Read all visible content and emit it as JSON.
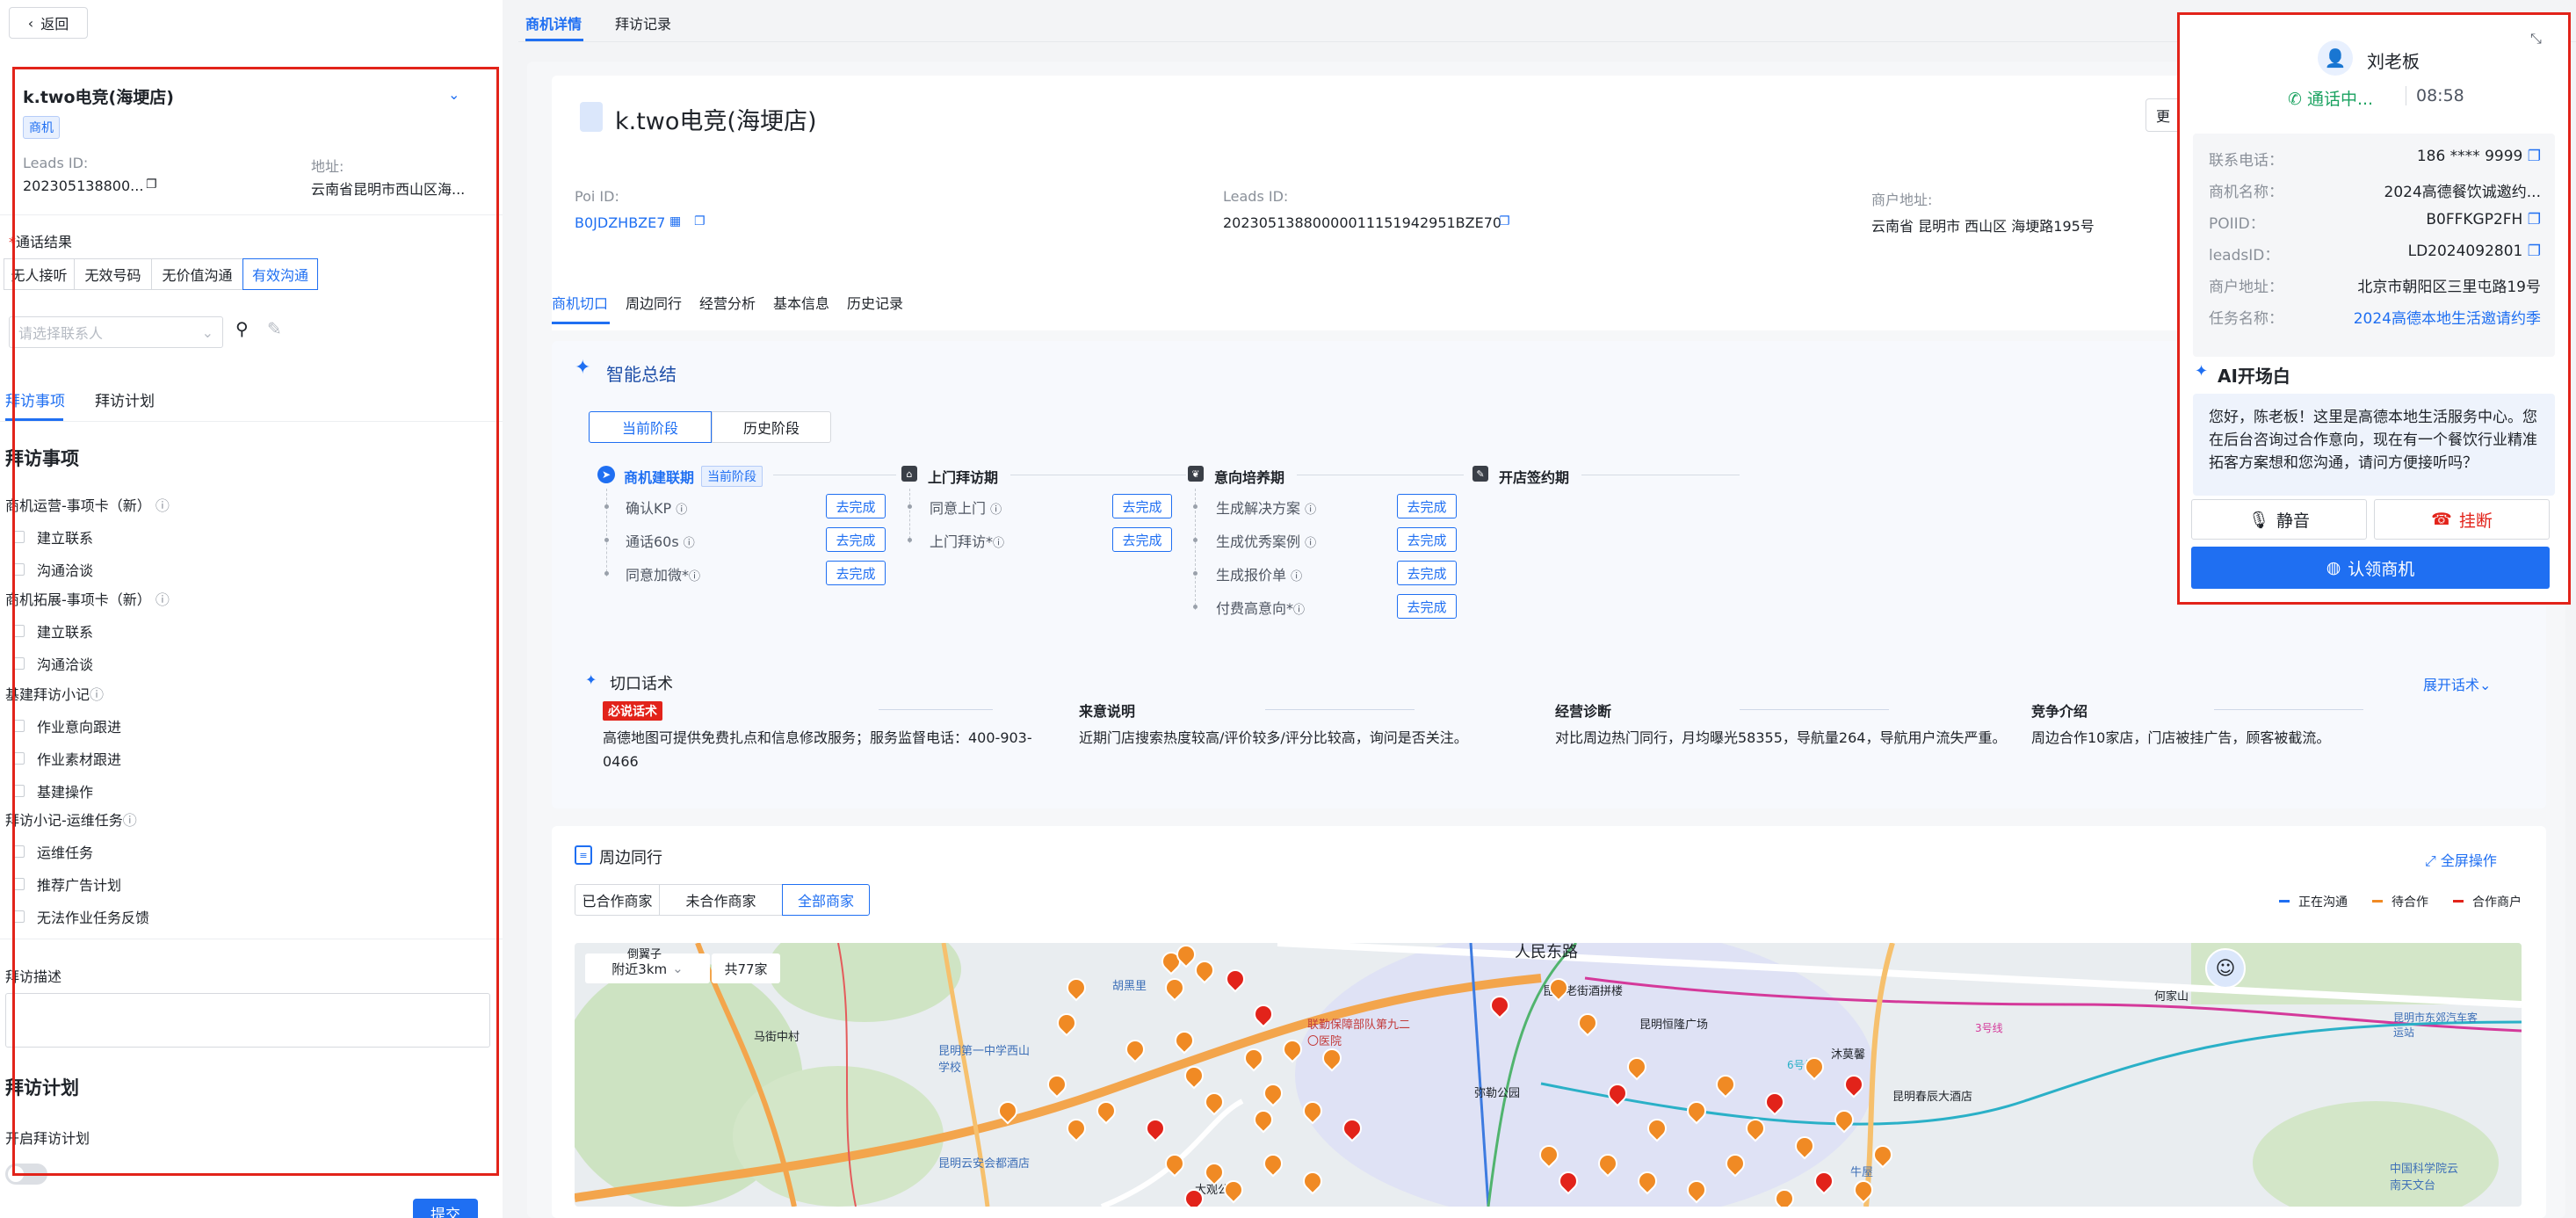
{
  "left": {
    "back_label": "返回",
    "store_name": "k.two电竞(海埂店)",
    "badge": "商机",
    "leads_id_label": "Leads ID:",
    "leads_id_value": "202305138800...",
    "address_label": "地址:",
    "address_value": "云南省昆明市西山区海...",
    "call_result_label": "通话结果",
    "call_results": [
      "无人接听",
      "无效号码",
      "无价值沟通",
      "有效沟通"
    ],
    "contact_placeholder": "请选择联系人",
    "tabs": [
      "拜访事项",
      "拜访计划"
    ],
    "visit_items_title": "拜访事项",
    "groups": [
      {
        "title": "商机运营-事项卡（新）",
        "items": [
          "建立联系",
          "沟通洽谈"
        ]
      },
      {
        "title": "商机拓展-事项卡（新）",
        "items": [
          "建立联系",
          "沟通洽谈"
        ]
      },
      {
        "title": "基建拜访小记",
        "items": [
          "作业意向跟进",
          "作业素材跟进",
          "基建操作"
        ]
      },
      {
        "title": "拜访小记-运维任务",
        "items": [
          "运维任务",
          "推荐广告计划",
          "无法作业任务反馈"
        ]
      }
    ],
    "visit_desc_label": "拜访描述",
    "visit_plan_title": "拜访计划",
    "enable_plan_label": "开启拜访计划",
    "submit_label": "提交"
  },
  "main": {
    "top_tabs": [
      "商机详情",
      "拜访记录"
    ],
    "store_name": "k.two电竞(海埂店)",
    "more_label": "更",
    "poi_label": "Poi ID:",
    "poi_value": "B0JDZHBZE7",
    "leads_label": "Leads ID:",
    "leads_value": "20230513880000011151942951BZE70",
    "addr_label": "商户地址:",
    "addr_value": "云南省 昆明市 西山区 海埂路195号",
    "sub_tabs": [
      "商机切口",
      "周边同行",
      "经营分析",
      "基本信息",
      "历史记录"
    ],
    "smart_title": "智能总结",
    "stage_tabs": [
      "当前阶段",
      "历史阶段"
    ],
    "stages": [
      {
        "name": "商机建联期",
        "tag": "当前阶段",
        "items": [
          "确认KP",
          "通话60s",
          "同意加微*"
        ]
      },
      {
        "name": "上门拜访期",
        "items": [
          "同意上门",
          "上门拜访*"
        ]
      },
      {
        "name": "意向培养期",
        "items": [
          "生成解决方案",
          "生成优秀案例",
          "生成报价单",
          "付费高意向*"
        ]
      },
      {
        "name": "开店签约期",
        "items": []
      }
    ],
    "done_label": "去完成",
    "cut_title": "切口话术",
    "expand_label": "展开话术",
    "scripts": [
      {
        "title": "",
        "tag": "必说话术",
        "text": "高德地图可提供免费扎点和信息修改服务；服务监督电话：400-903-0466"
      },
      {
        "title": "来意说明",
        "text": "近期门店搜索热度较高/评价较多/评分比较高，询问是否关注。"
      },
      {
        "title": "经营诊断",
        "text": "对比周边热门同行，月均曝光58355，导航量264，导航用户流失严重。"
      },
      {
        "title": "竞争介绍",
        "text": "周边合作10家店，门店被挂广告，顾客被截流。"
      }
    ],
    "peer_title": "周边同行",
    "fullscreen_label": "全屏操作",
    "peer_tabs": [
      "已合作商家",
      "未合作商家",
      "全部商家"
    ],
    "legend": [
      "正在沟通",
      "待合作",
      "合作商户"
    ],
    "legend_colors": [
      "#1f6ff2",
      "#f08a24",
      "#e2231a"
    ],
    "map_filter": "附近3km",
    "map_total": "共77家",
    "map_labels": [
      "倒翼子",
      "胡黑里",
      "马街中村",
      "昆明第一中学西山学校",
      "联勤保障部队第九二〇医院",
      "昆明云安会都酒店",
      "大观公园",
      "人民东路",
      "昆明老街酒拼楼",
      "昆明恒隆广场",
      "沐莫馨",
      "昆明春辰大酒店",
      "牛屋",
      "何家山",
      "3号线",
      "6号线",
      "中国科学院云南天文台",
      "昆明市东郊汽车客运站",
      "弥勒公园"
    ]
  },
  "call": {
    "contact_name": "刘老板",
    "status": "通话中...",
    "duration": "08:58",
    "fields": [
      {
        "k": "联系电话：",
        "v": "186 **** 9999"
      },
      {
        "k": "商机名称：",
        "v": "2024高德餐饮诚邀约..."
      },
      {
        "k": "POIID：",
        "v": "B0FFKGP2FH"
      },
      {
        "k": "leadsID：",
        "v": "LD2024092801"
      },
      {
        "k": "商户地址：",
        "v": "北京市朝阳区三里屯路19号"
      },
      {
        "k": "任务名称：",
        "v": "2024高德本地生活邀请约季"
      }
    ],
    "ai_title": "AI开场白",
    "ai_text": "您好，陈老板！这里是高德本地生活服务中心。您在后台咨询过合作意向，现在有一个餐饮行业精准拓客方案想和您沟通，请问方便接听吗？",
    "mute_label": "静音",
    "hangup_label": "挂断",
    "claim_label": "认领商机"
  }
}
